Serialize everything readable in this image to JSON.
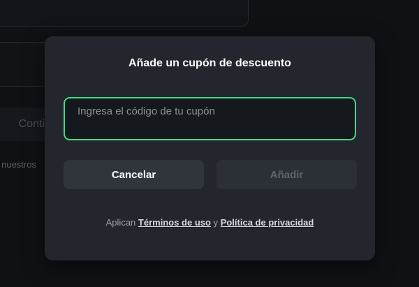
{
  "background": {
    "continue_label": "Continuar",
    "terms_fragment": "s nuestros"
  },
  "modal": {
    "title": "Añade un cupón de descuento",
    "input": {
      "placeholder": "Ingresa el código de tu cupón",
      "value": ""
    },
    "cancel_label": "Cancelar",
    "add_label": "Añadir",
    "legal": {
      "prefix": "Aplican",
      "terms_link": "Términos de uso",
      "conjunction": "y",
      "privacy_link": "Política de privacidad"
    }
  },
  "colors": {
    "accent": "#3ddc84",
    "modal_bg": "#23272d",
    "page_bg": "#0f1115"
  }
}
